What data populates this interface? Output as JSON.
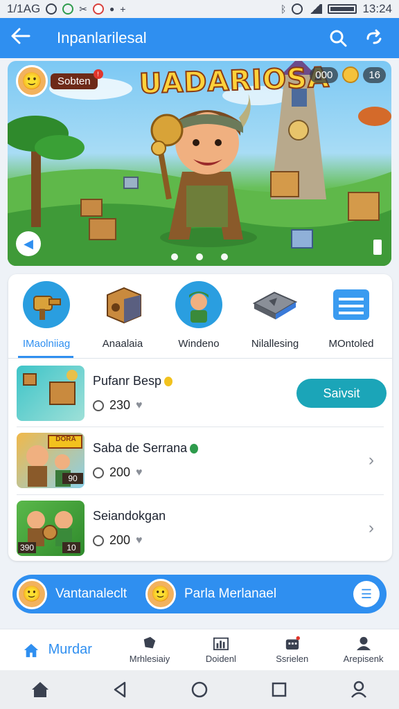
{
  "status_bar": {
    "left_text": "1/1AG",
    "time": "13:24"
  },
  "app_bar": {
    "title": "Inpanlarilesal"
  },
  "banner": {
    "game_title": "UADARIOSA",
    "user_name": "Sobten",
    "counter_1": "000",
    "counter_2": "16"
  },
  "categories": [
    {
      "label": "IMaolniiag",
      "icon": "hammer-icon"
    },
    {
      "label": "Anaalaia",
      "icon": "crate-icon"
    },
    {
      "label": "Windeno",
      "icon": "character-icon"
    },
    {
      "label": "Nilallesing",
      "icon": "anvil-icon"
    },
    {
      "label": "MOntoled",
      "icon": "list-icon"
    }
  ],
  "items": [
    {
      "name": "Pufanr Besp",
      "count": "230",
      "action": "Saivsit"
    },
    {
      "name": "Saba de Serrana",
      "count": "200",
      "thumb_top": "DORA",
      "thumb_badge": "90"
    },
    {
      "name": "Seiandokgan",
      "count": "200",
      "thumb_left": "390",
      "thumb_right": "10"
    }
  ],
  "strip": {
    "text_1": "Vantanaleclt",
    "text_2": "Parla Merlanael"
  },
  "bottom_nav": [
    {
      "label": "Murdar",
      "icon": "home-icon"
    },
    {
      "label": "Mrhlesiaiy",
      "icon": "puzzle-icon"
    },
    {
      "label": "Doidenl",
      "icon": "chart-icon"
    },
    {
      "label": "Ssrielen",
      "icon": "shop-icon"
    },
    {
      "label": "Arepisenk",
      "icon": "profile-icon"
    }
  ]
}
